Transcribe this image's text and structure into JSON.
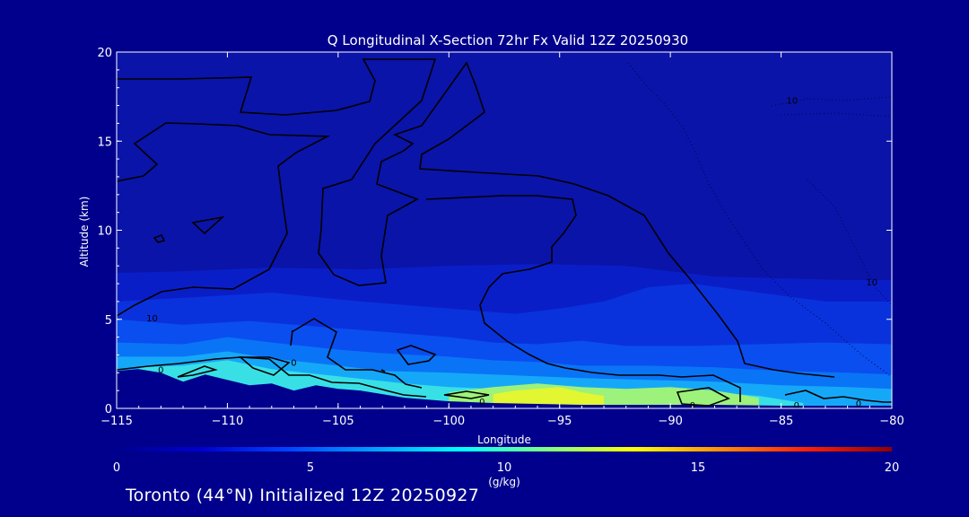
{
  "chart_data": {
    "type": "heatmap",
    "title": "Q Longitudinal X-Section 72hr  Fx Valid 12Z 20250930",
    "xlabel": "Longitude",
    "ylabel": "Altitude (km)",
    "xlim": [
      -115,
      -80
    ],
    "ylim": [
      0,
      20
    ],
    "x_ticks": [
      -115,
      -110,
      -105,
      -100,
      -95,
      -90,
      -85,
      -80
    ],
    "x_tick_labels": [
      "−115",
      "−110",
      "−105",
      "−100",
      "−95",
      "−90",
      "−85",
      "−80"
    ],
    "y_ticks": [
      0,
      5,
      10,
      15,
      20
    ],
    "y_tick_labels": [
      "0",
      "5",
      "10",
      "15",
      "20"
    ],
    "colorbar": {
      "min": 0,
      "max": 20,
      "ticks": [
        0,
        5,
        10,
        15,
        20
      ],
      "tick_labels": [
        "0",
        "5",
        "10",
        "15",
        "20"
      ],
      "units": "(g/kg)",
      "stops": [
        "#00008c",
        "#0000d0",
        "#0044ff",
        "#00a0ff",
        "#00ffff",
        "#80ff80",
        "#ffff00",
        "#ff9000",
        "#ff2000",
        "#900000"
      ]
    },
    "moisture_layers": [
      {
        "value": 1,
        "color": "#0a1ec8",
        "top": [
          [
            -115,
            7.6
          ],
          [
            -112,
            7.7
          ],
          [
            -108,
            7.9
          ],
          [
            -104,
            7.8
          ],
          [
            -100,
            8.0
          ],
          [
            -96,
            8.1
          ],
          [
            -92,
            8.0
          ],
          [
            -90,
            7.7
          ],
          [
            -88,
            7.4
          ],
          [
            -85,
            7.3
          ],
          [
            -82,
            7.2
          ],
          [
            -80,
            7.2
          ]
        ]
      },
      {
        "value": 2,
        "color": "#0a32dc",
        "top": [
          [
            -115,
            6.0
          ],
          [
            -112,
            6.2
          ],
          [
            -108,
            6.5
          ],
          [
            -104,
            6.0
          ],
          [
            -100,
            5.6
          ],
          [
            -97,
            5.3
          ],
          [
            -95,
            5.6
          ],
          [
            -93,
            6.0
          ],
          [
            -91,
            6.8
          ],
          [
            -89,
            7.0
          ],
          [
            -86,
            6.5
          ],
          [
            -83,
            6.0
          ],
          [
            -80,
            6.0
          ]
        ]
      },
      {
        "value": 3,
        "color": "#0a4ef0",
        "top": [
          [
            -115,
            5.0
          ],
          [
            -112,
            4.7
          ],
          [
            -109,
            4.9
          ],
          [
            -106,
            4.6
          ],
          [
            -103,
            4.3
          ],
          [
            -100,
            4.0
          ],
          [
            -98,
            3.7
          ],
          [
            -96,
            3.6
          ],
          [
            -94,
            3.8
          ],
          [
            -92,
            3.5
          ],
          [
            -89,
            3.5
          ],
          [
            -86,
            3.6
          ],
          [
            -83,
            3.7
          ],
          [
            -80,
            3.6
          ]
        ]
      },
      {
        "value": 4,
        "color": "#0a74f6",
        "top": [
          [
            -115,
            3.7
          ],
          [
            -112,
            3.6
          ],
          [
            -110,
            4.0
          ],
          [
            -108,
            3.7
          ],
          [
            -105,
            3.3
          ],
          [
            -103,
            3.1
          ],
          [
            -100,
            2.9
          ],
          [
            -98,
            2.7
          ],
          [
            -96,
            2.6
          ],
          [
            -94,
            2.4
          ],
          [
            -91,
            2.4
          ],
          [
            -88,
            2.3
          ],
          [
            -85,
            2.1
          ],
          [
            -82,
            2.0
          ],
          [
            -80,
            1.9
          ]
        ]
      },
      {
        "value": 6,
        "color": "#16a8f8",
        "top": [
          [
            -115,
            2.9
          ],
          [
            -112,
            2.9
          ],
          [
            -110,
            3.2
          ],
          [
            -108,
            2.8
          ],
          [
            -105,
            2.4
          ],
          [
            -103,
            2.1
          ],
          [
            -100,
            2.0
          ],
          [
            -98,
            1.9
          ],
          [
            -96,
            1.8
          ],
          [
            -94,
            1.7
          ],
          [
            -91,
            1.6
          ],
          [
            -88,
            1.5
          ],
          [
            -85,
            1.3
          ],
          [
            -82,
            1.2
          ],
          [
            -80,
            1.1
          ]
        ]
      },
      {
        "value": 8,
        "color": "#38e0e6",
        "top": [
          [
            -114,
            2.3
          ],
          [
            -112,
            2.4
          ],
          [
            -110,
            2.7
          ],
          [
            -108,
            2.2
          ],
          [
            -105,
            1.8
          ],
          [
            -102,
            1.4
          ],
          [
            -100,
            1.2
          ],
          [
            -98,
            1.1
          ],
          [
            -96,
            1.0
          ],
          [
            -94,
            1.0
          ],
          [
            -91,
            1.0
          ],
          [
            -88,
            0.9
          ],
          [
            -86,
            0.7
          ],
          [
            -84,
            0.3
          ]
        ]
      },
      {
        "value": 10,
        "color": "#9cf27a",
        "top": [
          [
            -100,
            0.9
          ],
          [
            -98,
            1.2
          ],
          [
            -96,
            1.4
          ],
          [
            -94,
            1.2
          ],
          [
            -92,
            1.1
          ],
          [
            -90,
            1.2
          ],
          [
            -88,
            1.0
          ],
          [
            -86,
            0.6
          ]
        ]
      },
      {
        "value": 11,
        "color": "#e2f632",
        "top": [
          [
            -98,
            0.8
          ],
          [
            -97,
            1.0
          ],
          [
            -95,
            1.2
          ],
          [
            -94,
            0.9
          ],
          [
            -93,
            0.7
          ]
        ]
      }
    ],
    "terrain_top": [
      [
        -115,
        2.1
      ],
      [
        -114,
        2.2
      ],
      [
        -113,
        2.0
      ],
      [
        -112,
        1.5
      ],
      [
        -111,
        1.9
      ],
      [
        -110,
        1.6
      ],
      [
        -109,
        1.3
      ],
      [
        -108,
        1.4
      ],
      [
        -107,
        1.0
      ],
      [
        -106,
        1.3
      ],
      [
        -105,
        1.1
      ],
      [
        -104,
        1.0
      ],
      [
        -103,
        0.8
      ],
      [
        -102,
        0.6
      ],
      [
        -101,
        0.5
      ],
      [
        -100,
        0.4
      ],
      [
        -98,
        0.3
      ],
      [
        -96,
        0.25
      ],
      [
        -94,
        0.2
      ],
      [
        -91,
        0.2
      ],
      [
        -88,
        0.2
      ],
      [
        -85,
        0.15
      ],
      [
        -82,
        0.15
      ],
      [
        -80,
        0.15
      ]
    ],
    "contour_labels": [
      {
        "text": "10",
        "x": -84.5,
        "y": 17.3
      },
      {
        "text": "10",
        "x": -80.9,
        "y": 7.1
      },
      {
        "text": "10",
        "x": -113.4,
        "y": 5.1
      },
      {
        "text": "0",
        "x": -113.0,
        "y": 2.2
      },
      {
        "text": "0",
        "x": -107.0,
        "y": 2.6
      },
      {
        "text": "0",
        "x": -98.5,
        "y": 0.4
      },
      {
        "text": "0",
        "x": -89.0,
        "y": 0.2
      },
      {
        "text": "0",
        "x": -84.3,
        "y": 0.2
      },
      {
        "text": "0",
        "x": -81.5,
        "y": 0.3
      }
    ]
  },
  "footer": {
    "text": "Toronto (44°N) Initialized 12Z 20250927"
  }
}
